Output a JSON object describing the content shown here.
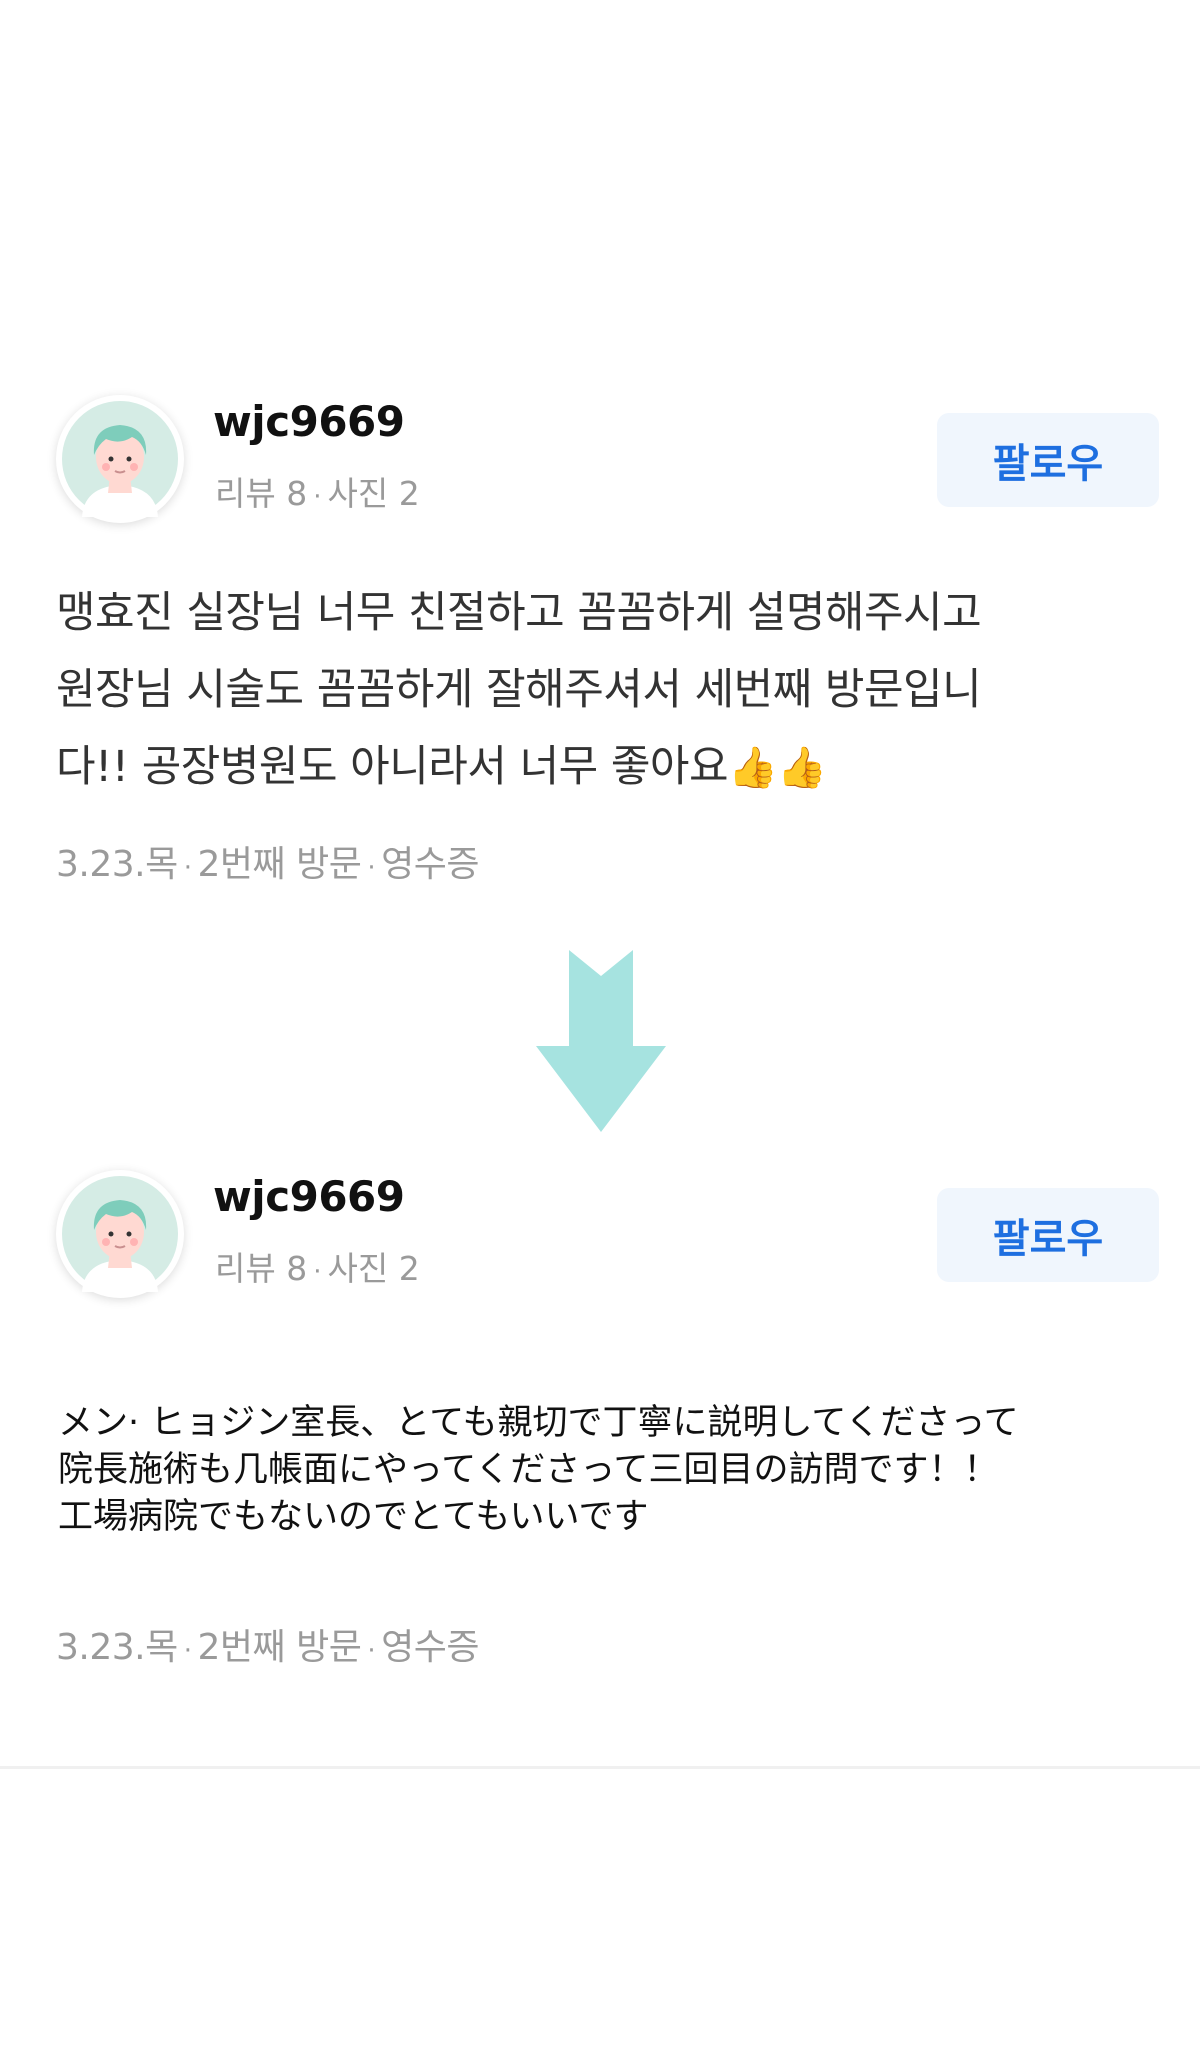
{
  "original_review": {
    "username": "wjc9669",
    "meta_reviews": "리뷰 8",
    "meta_photos": "사진 2",
    "follow_label": "팔로우",
    "content": "맹효진 실장님 너무 친절하고 꼼꼼하게 설명해주시고\n원장님 시술도 꼼꼼하게 잘해주셔서 세번째 방문입니\n다!! 공장병원도 아니라서 너무 좋아요",
    "footer_date": "3.23.목",
    "footer_visit": "2번째 방문",
    "footer_receipt": "영수증"
  },
  "translated_review": {
    "username": "wjc9669",
    "meta_reviews": "리뷰 8",
    "meta_photos": "사진 2",
    "follow_label": "팔로우",
    "content": "メン· ヒョジン室長、とても親切で丁寧に説明してくださって\n院長施術も几帳面にやってくださって三回目の訪問です！！\n工場病院でもないのでとてもいいです",
    "footer_date": "3.23.목",
    "footer_visit": "2번째 방문",
    "footer_receipt": "영수증"
  },
  "icons": {
    "avatar": "avatar-icon",
    "emoji": "thumbs-up-icon",
    "arrow": "arrow-down-icon"
  },
  "colors": {
    "follow_text": "#1e6fe0",
    "follow_bg": "#f0f6fd",
    "arrow": "#a6e3e0",
    "meta_text": "#9a9a9a"
  }
}
